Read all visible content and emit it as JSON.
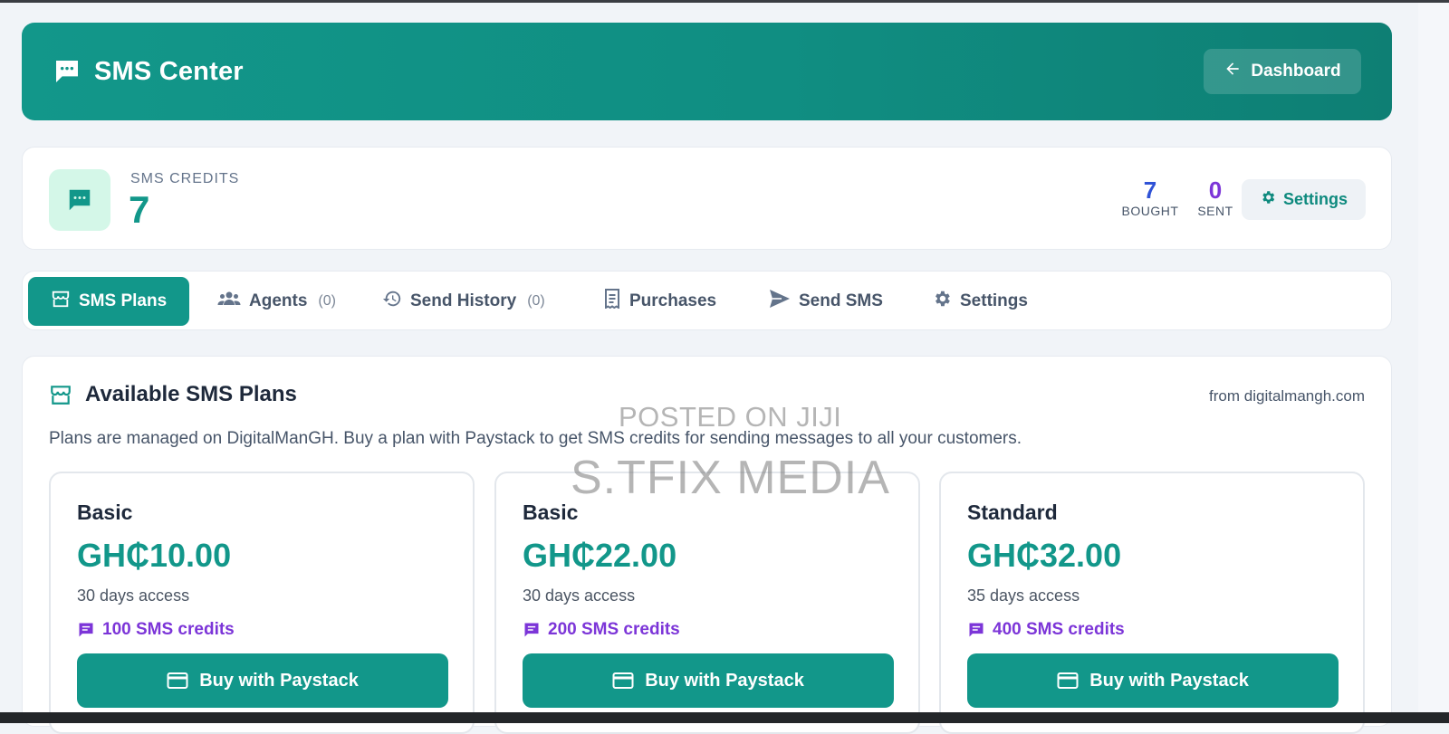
{
  "header": {
    "title": "SMS Center",
    "dashboard_label": "Dashboard"
  },
  "credits": {
    "label": "SMS CREDITS",
    "value": "7",
    "bought_value": "7",
    "bought_label": "BOUGHT",
    "sent_value": "0",
    "sent_label": "SENT",
    "settings_label": "Settings"
  },
  "tabs": [
    {
      "label": "SMS Plans",
      "count": ""
    },
    {
      "label": "Agents",
      "count": "(0)"
    },
    {
      "label": "Send History",
      "count": "(0)"
    },
    {
      "label": "Purchases",
      "count": ""
    },
    {
      "label": "Send SMS",
      "count": ""
    },
    {
      "label": "Settings",
      "count": ""
    }
  ],
  "plans_section": {
    "title": "Available SMS Plans",
    "source": "from digitalmangh.com",
    "description": "Plans are managed on DigitalManGH. Buy a plan with Paystack to get SMS credits for sending messages to all your customers."
  },
  "plans": [
    {
      "name": "Basic",
      "price": "GH₵10.00",
      "duration": "30 days access",
      "credits": "100 SMS credits",
      "button": "Buy with Paystack"
    },
    {
      "name": "Basic",
      "price": "GH₵22.00",
      "duration": "30 days access",
      "credits": "200 SMS credits",
      "button": "Buy with Paystack"
    },
    {
      "name": "Standard",
      "price": "GH₵32.00",
      "duration": "35 days access",
      "credits": "400 SMS credits",
      "button": "Buy with Paystack"
    }
  ],
  "watermark": {
    "line1": "POSTED ON JIJI",
    "line2": "S.TFIX MEDIA"
  },
  "colors": {
    "primary": "#12978a",
    "bought": "#2f52d6",
    "sent": "#7c35d8",
    "credits_text": "#7c35d8"
  }
}
